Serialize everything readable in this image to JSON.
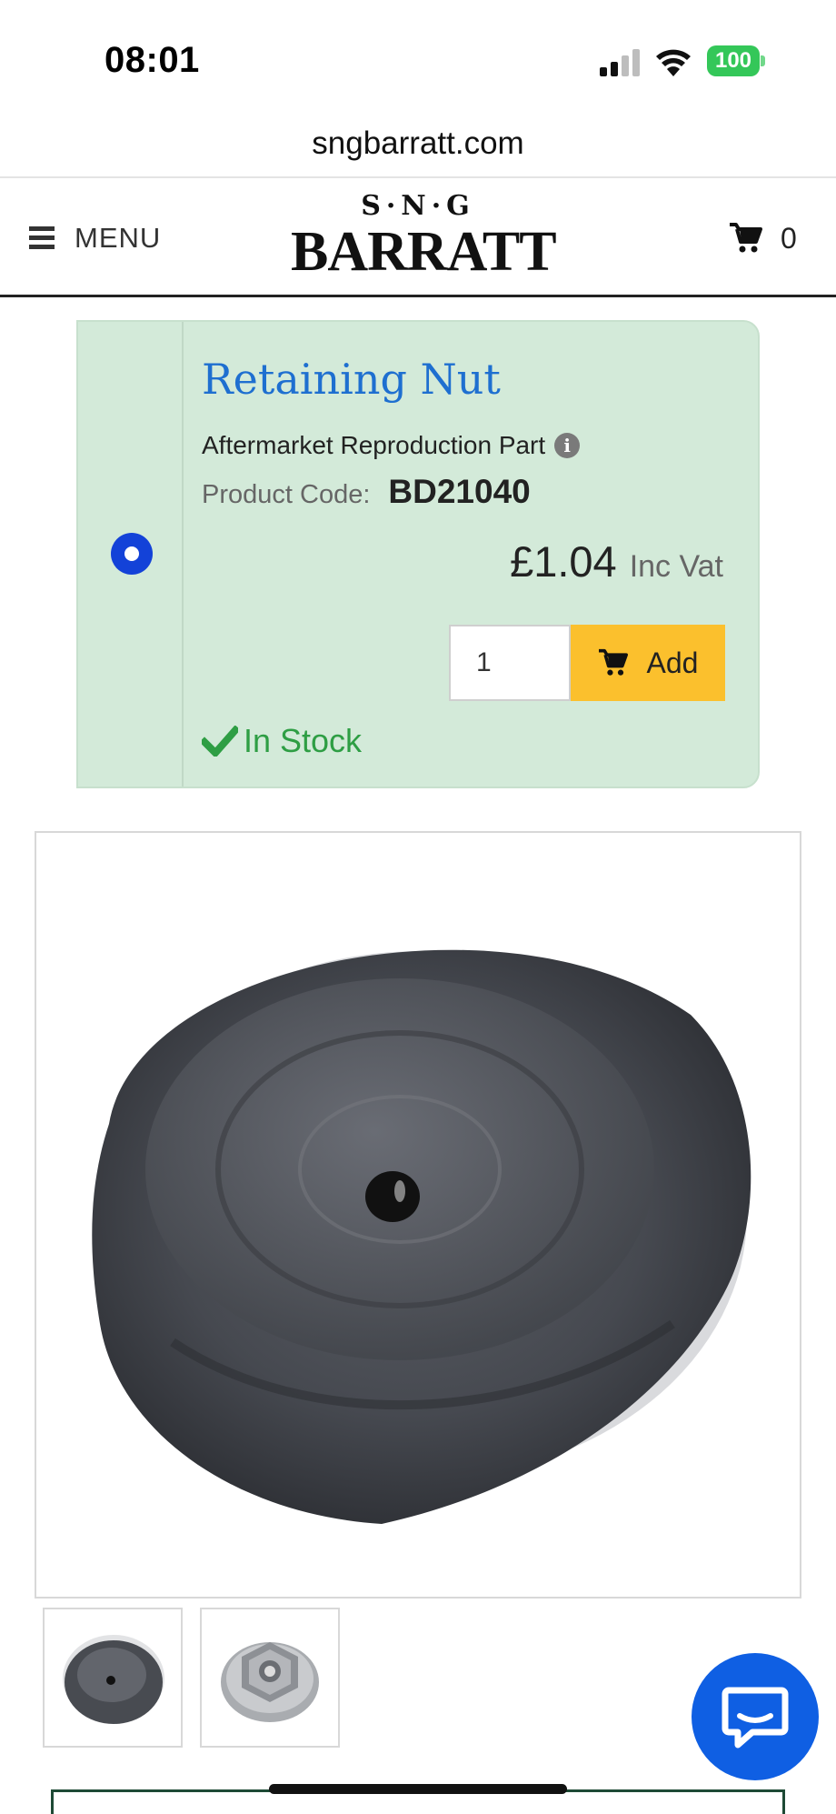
{
  "status_bar": {
    "time": "08:01",
    "battery": "100",
    "icons": [
      "signal-icon",
      "wifi-icon",
      "battery-icon"
    ]
  },
  "browser": {
    "url": "sngbarratt.com"
  },
  "header": {
    "menu_label": "MENU",
    "logo_top": "S·N·G",
    "logo_bottom": "BARRATT",
    "cart_count": "0"
  },
  "product": {
    "title": "Retaining Nut",
    "type": "Aftermarket Reproduction Part",
    "code_label": "Product Code:",
    "code": "BD21040",
    "price": "£1.04",
    "price_suffix": "Inc Vat",
    "quantity": "1",
    "add_label": "Add",
    "stock": "In Stock",
    "selected": true
  },
  "gallery": {
    "thumbnails": [
      "thumbnail-rubber-nut",
      "thumbnail-metal-nut"
    ]
  },
  "colors": {
    "card_bg": "#d3ead9",
    "title": "#1e6fd0",
    "add_button": "#fbc02d",
    "stock": "#2e9e44",
    "radio": "#1342d8",
    "chat": "#0f5fe3"
  }
}
